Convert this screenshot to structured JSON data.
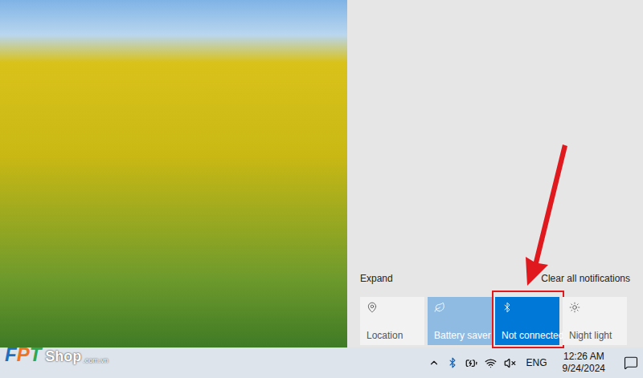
{
  "action_center": {
    "expand": "Expand",
    "clear": "Clear all notifications",
    "tiles": [
      {
        "label": "Location",
        "icon": "location",
        "on": false,
        "disabled": false,
        "highlighted": false
      },
      {
        "label": "Battery saver",
        "icon": "battery-saver",
        "on": true,
        "disabled": true,
        "highlighted": false
      },
      {
        "label": "Not connected",
        "icon": "bluetooth",
        "on": true,
        "disabled": false,
        "highlighted": true
      },
      {
        "label": "Night light",
        "icon": "night-light",
        "on": false,
        "disabled": false,
        "highlighted": false
      }
    ]
  },
  "taskbar": {
    "language": "ENG",
    "time": "12:26 AM",
    "date": "9/24/2024",
    "bluetooth_on": true,
    "muted": true
  },
  "watermark": {
    "letters": [
      {
        "text": "F",
        "color": "#1e6fc0"
      },
      {
        "text": "P",
        "color": "#f0741f"
      },
      {
        "text": "T",
        "color": "#2fa84f"
      }
    ],
    "word": "Shop",
    "suffix": ".com.vn"
  }
}
